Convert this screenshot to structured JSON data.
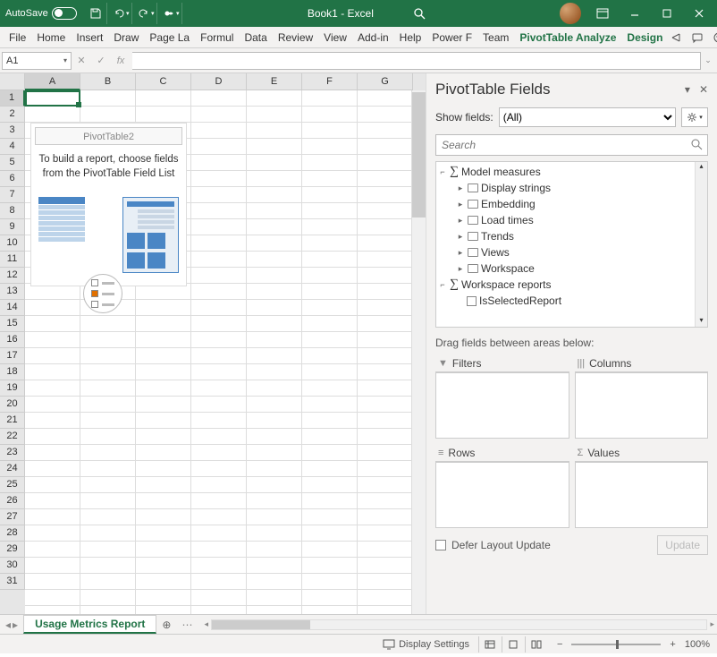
{
  "titlebar": {
    "autosave_label": "AutoSave",
    "autosave_state": "Off",
    "doc_title": "Book1 - Excel"
  },
  "ribbon": {
    "tabs": [
      "File",
      "Home",
      "Insert",
      "Draw",
      "Page La",
      "Formul",
      "Data",
      "Review",
      "View",
      "Add-in",
      "Help",
      "Power F",
      "Team"
    ],
    "context_tabs": [
      "PivotTable Analyze",
      "Design"
    ]
  },
  "name_box": "A1",
  "formula_bar_fx": "fx",
  "columns": [
    "A",
    "B",
    "C",
    "D",
    "E",
    "F",
    "G"
  ],
  "rows_visible": 31,
  "selected_cell": "A1",
  "pivot_placeholder": {
    "name": "PivotTable2",
    "message": "To build a report, choose fields from the PivotTable Field List"
  },
  "pane": {
    "title": "PivotTable Fields",
    "show_fields_label": "Show fields:",
    "show_fields_value": "(All)",
    "search_placeholder": "Search",
    "tree": [
      {
        "level": 0,
        "type": "group",
        "label": "Model measures",
        "expanded": true
      },
      {
        "level": 1,
        "type": "folder",
        "label": "Display strings"
      },
      {
        "level": 1,
        "type": "folder",
        "label": "Embedding"
      },
      {
        "level": 1,
        "type": "folder",
        "label": "Load times"
      },
      {
        "level": 1,
        "type": "folder",
        "label": "Trends"
      },
      {
        "level": 1,
        "type": "folder",
        "label": "Views"
      },
      {
        "level": 1,
        "type": "folder",
        "label": "Workspace"
      },
      {
        "level": 0,
        "type": "group",
        "label": "Workspace reports",
        "expanded": true
      },
      {
        "level": 2,
        "type": "field",
        "label": "IsSelectedReport"
      }
    ],
    "drag_label": "Drag fields between areas below:",
    "areas": {
      "filters": "Filters",
      "columns": "Columns",
      "rows": "Rows",
      "values": "Values"
    },
    "defer_label": "Defer Layout Update",
    "update_label": "Update"
  },
  "sheet_tabs": {
    "active": "Usage Metrics Report"
  },
  "statusbar": {
    "display_settings": "Display Settings",
    "zoom": "100%"
  }
}
